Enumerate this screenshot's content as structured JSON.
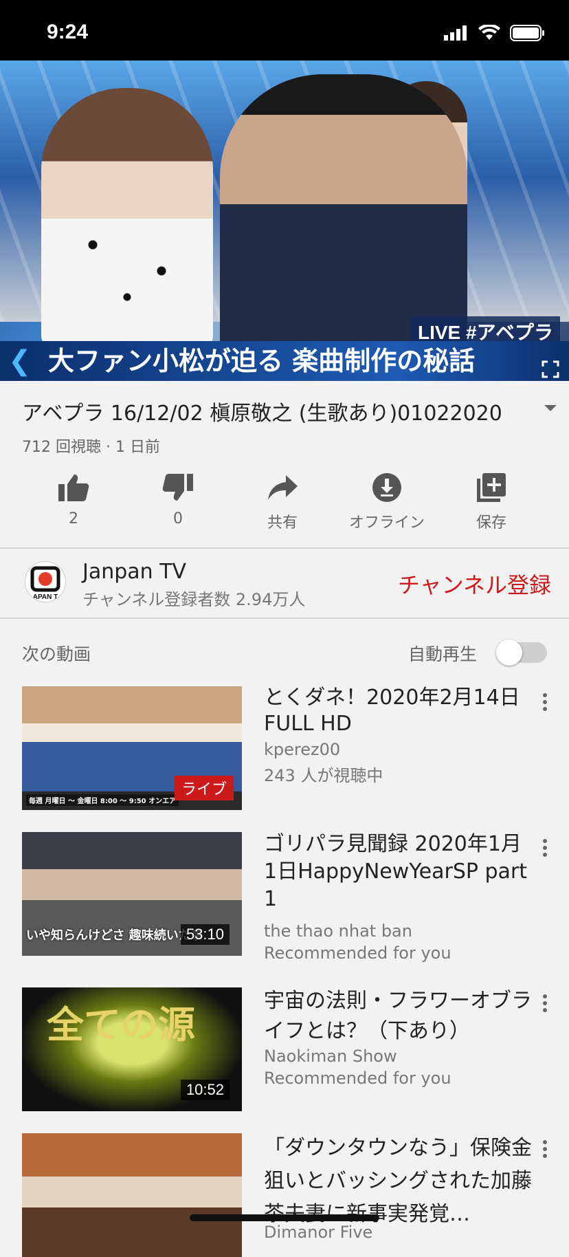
{
  "status_bar": {
    "time": "9:24"
  },
  "player": {
    "live_badge": "LIVE #アベプラ",
    "caption": "大ファン小松が迫る 楽曲制作の秘話",
    "progress_fraction": 0.78
  },
  "video": {
    "title": "アベプラ 16/12/02 槇原敬之 (生歌あり)01022020",
    "meta": "712 回視聴 · 1 日前"
  },
  "actions": [
    {
      "icon": "thumbs-up-icon",
      "label": "2"
    },
    {
      "icon": "thumbs-down-icon",
      "label": "0"
    },
    {
      "icon": "share-icon",
      "label": "共有"
    },
    {
      "icon": "download-icon",
      "label": "オフライン"
    },
    {
      "icon": "save-playlist-icon",
      "label": "保存"
    }
  ],
  "channel": {
    "name": "Janpan TV",
    "subscribers": "チャンネル登録者数 2.94万人",
    "subscribe_label": "チャンネル登録",
    "avatar_text": "APAN T"
  },
  "up_next": {
    "label": "次の動画",
    "autoplay_label": "自動再生",
    "autoplay_on": false
  },
  "videos": [
    {
      "title": "とくダネ！2020年2月14日 FULL HD",
      "channel": "kperez00",
      "extra": "243 人が視聴中",
      "badge": "ライブ",
      "thumb_text": "毎週 月曜日 〜 金曜日 8:00 〜 9:50 オンエア"
    },
    {
      "title": "ゴリパラ見聞録  2020年1月1日HappyNewYearSP part 1",
      "channel": "the thao nhat ban",
      "extra": "Recommended for you",
      "duration": "53:10",
      "thumb_text": "いや知らんけどさ 趣味続いた事"
    },
    {
      "title": "宇宙の法則・フラワーオブライフとは？（下あり）",
      "channel": "Naokiman Show",
      "extra": "Recommended for you",
      "duration": "10:52",
      "thumb_text": "全ての源"
    },
    {
      "title": "「ダウンタウンなう」保険金狙いとバッシングされた加藤茶夫妻に新事実発覚…",
      "channel": "Dimanor Five"
    }
  ]
}
